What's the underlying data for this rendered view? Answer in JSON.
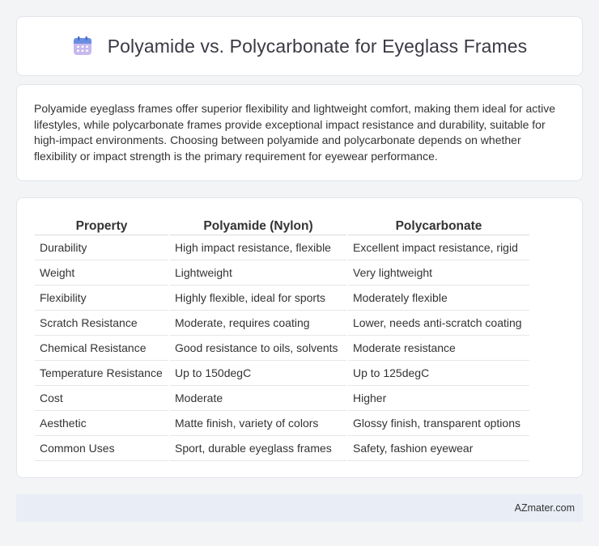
{
  "header": {
    "title": "Polyamide vs. Polycarbonate for Eyeglass Frames",
    "icon": "calendar-icon"
  },
  "intro": {
    "text": "Polyamide eyeglass frames offer superior flexibility and lightweight comfort, making them ideal for active lifestyles, while polycarbonate frames provide exceptional impact resistance and durability, suitable for high-impact environments. Choosing between polyamide and polycarbonate depends on whether flexibility or impact strength is the primary requirement for eyewear performance."
  },
  "table": {
    "headers": [
      "Property",
      "Polyamide (Nylon)",
      "Polycarbonate"
    ],
    "rows": [
      [
        "Durability",
        "High impact resistance, flexible",
        "Excellent impact resistance, rigid"
      ],
      [
        "Weight",
        "Lightweight",
        "Very lightweight"
      ],
      [
        "Flexibility",
        "Highly flexible, ideal for sports",
        "Moderately flexible"
      ],
      [
        "Scratch Resistance",
        "Moderate, requires coating",
        "Lower, needs anti-scratch coating"
      ],
      [
        "Chemical Resistance",
        "Good resistance to oils, solvents",
        "Moderate resistance"
      ],
      [
        "Temperature Resistance",
        "Up to 150degC",
        "Up to 125degC"
      ],
      [
        "Cost",
        "Moderate",
        "Higher"
      ],
      [
        "Aesthetic",
        "Matte finish, variety of colors",
        "Glossy finish, transparent options"
      ],
      [
        "Common Uses",
        "Sport, durable eyeglass frames",
        "Safety, fashion eyewear"
      ]
    ]
  },
  "footer": {
    "credit": "AZmater.com"
  },
  "colors": {
    "page_background": "#f3f4f6",
    "footer_background": "#e9edf6",
    "icon_header": "#6b8fe0",
    "icon_body": "#b9a7e6"
  }
}
